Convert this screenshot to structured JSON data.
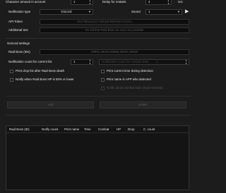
{
  "top": {
    "character_label": "Character amount in account",
    "character_value": "1",
    "delay_label": "Delay for restarts",
    "delay_value": "4",
    "delay_unit": "sec"
  },
  "notification": {
    "type_label": "Notification type",
    "type_value": "Discord",
    "sound_label": "Sound",
    "sound_value": "1",
    "play_icon": "play-icon"
  },
  "api": {
    "token_label": "API Token",
    "token_value": "Sn1T9Dw1Z2C-k2kQ9oR8XMuY4cG1s...",
    "additional_label": "Additional text",
    "additional_placeholder": "Go kill that Raid Boss as soon as possible!"
  },
  "general": {
    "section_label": "General settings",
    "raid_boss_label": "Raid Boss (IDs)",
    "raid_boss_value": "29001,29020,29068,29022,29028",
    "notify_count_label": "Notification count for current list",
    "notify_count_value": "1",
    "combat_count_label": "Notification count for combat state",
    "combat_count_value": "1"
  },
  "checkboxes": {
    "print_drop": "Print drop list after Raid Boss death",
    "print_time": "Print current time during detection",
    "notify_hp": "Notify when Raid Boss HP is 50% or lower",
    "print_name": "Print name in APP who detected",
    "notify_combat": "Notify about combat state (Experimental)"
  },
  "buttons": {
    "add": "Add",
    "delete": "Delete"
  },
  "table": {
    "columns": [
      "Raid Boss (ID)",
      "Notify count",
      "Print name",
      "Time",
      "Combat",
      "HP",
      "Drop",
      "C. count"
    ]
  }
}
